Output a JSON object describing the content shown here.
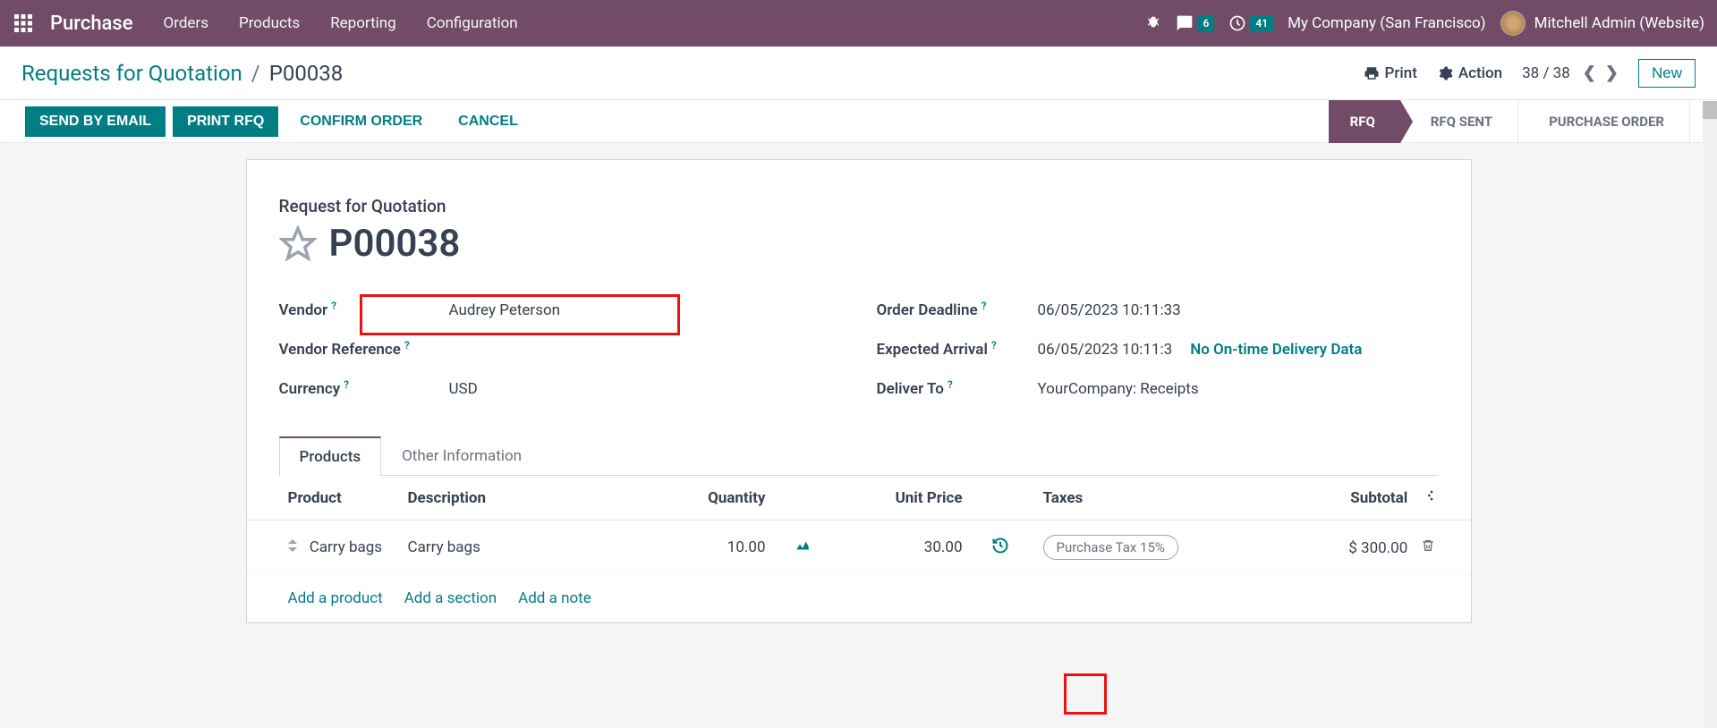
{
  "nav": {
    "brand": "Purchase",
    "items": [
      "Orders",
      "Products",
      "Reporting",
      "Configuration"
    ],
    "chat_badge": "6",
    "activity_badge": "41",
    "company": "My Company (San Francisco)",
    "user": "Mitchell Admin (Website)"
  },
  "breadcrumb": {
    "parent": "Requests for Quotation",
    "current": "P00038"
  },
  "cp": {
    "print": "Print",
    "action": "Action",
    "pager": "38 / 38",
    "new": "New"
  },
  "actions": {
    "send_email": "SEND BY EMAIL",
    "print_rfq": "PRINT RFQ",
    "confirm": "CONFIRM ORDER",
    "cancel": "CANCEL"
  },
  "status": {
    "rfq": "RFQ",
    "rfq_sent": "RFQ SENT",
    "po": "PURCHASE ORDER"
  },
  "form": {
    "title_label": "Request for Quotation",
    "doc_number": "P00038",
    "labels": {
      "vendor": "Vendor",
      "vendor_ref": "Vendor Reference",
      "currency": "Currency",
      "order_deadline": "Order Deadline",
      "expected_arrival": "Expected Arrival",
      "deliver_to": "Deliver To"
    },
    "values": {
      "vendor": "Audrey Peterson",
      "vendor_ref": "",
      "currency": "USD",
      "order_deadline": "06/05/2023 10:11:33",
      "expected_arrival": "06/05/2023 10:11:3",
      "deliver_to": "YourCompany: Receipts"
    },
    "no_delivery_link": "No On-time Delivery Data"
  },
  "tabs": {
    "products": "Products",
    "other": "Other Information"
  },
  "table": {
    "headers": {
      "product": "Product",
      "description": "Description",
      "quantity": "Quantity",
      "unit_price": "Unit Price",
      "taxes": "Taxes",
      "subtotal": "Subtotal"
    },
    "row": {
      "product": "Carry bags",
      "description": "Carry bags",
      "quantity": "10.00",
      "unit_price": "30.00",
      "tax": "Purchase Tax 15%",
      "subtotal": "$ 300.00"
    },
    "add_product": "Add a product",
    "add_section": "Add a section",
    "add_note": "Add a note"
  }
}
